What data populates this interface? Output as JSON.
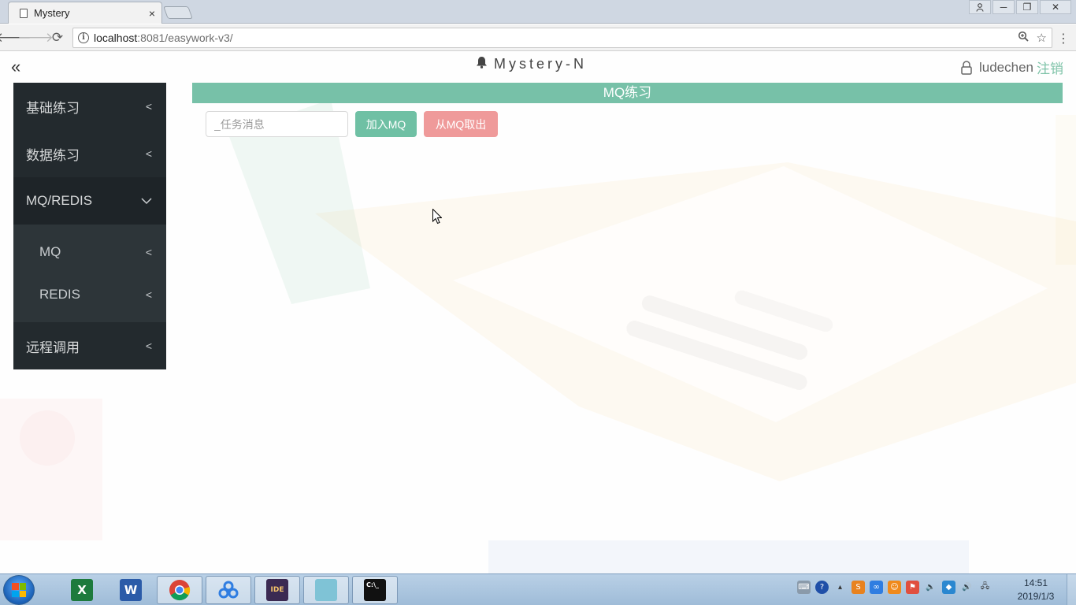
{
  "browser": {
    "tab_title": "Mystery",
    "tab_close": "×",
    "url_host": "localhost",
    "url_rest": ":8081/easywork-v3/"
  },
  "header": {
    "collapse_label": "«",
    "brand": "Mystery-N",
    "username": "ludechen",
    "logout": "注销"
  },
  "sidebar": {
    "items": [
      {
        "label": "基础练习",
        "chevron": "<"
      },
      {
        "label": "数据练习",
        "chevron": "<"
      },
      {
        "label": "MQ/REDIS",
        "chevron": "﹀"
      }
    ],
    "sub_items": [
      {
        "label": "MQ",
        "chevron": "<"
      },
      {
        "label": "REDIS",
        "chevron": "<"
      }
    ],
    "tail_items": [
      {
        "label": "远程调用",
        "chevron": "<"
      }
    ]
  },
  "main": {
    "title": "MQ练习",
    "input_placeholder": "_任务消息",
    "add_button": "加入MQ",
    "take_button": "从MQ取出"
  },
  "taskbar": {
    "apps": [
      "excel-icon",
      "word-icon",
      "chrome-icon",
      "baidu-netdisk-icon",
      "eclipse-javaee-icon",
      "notepad-icon",
      "cmd-icon"
    ],
    "clock_time": "14:51",
    "clock_date": "2019/1/3"
  },
  "colors": {
    "accent_green": "#77c1a8",
    "button_red": "#ef9a9a",
    "sidebar_bg": "#232a2e"
  }
}
